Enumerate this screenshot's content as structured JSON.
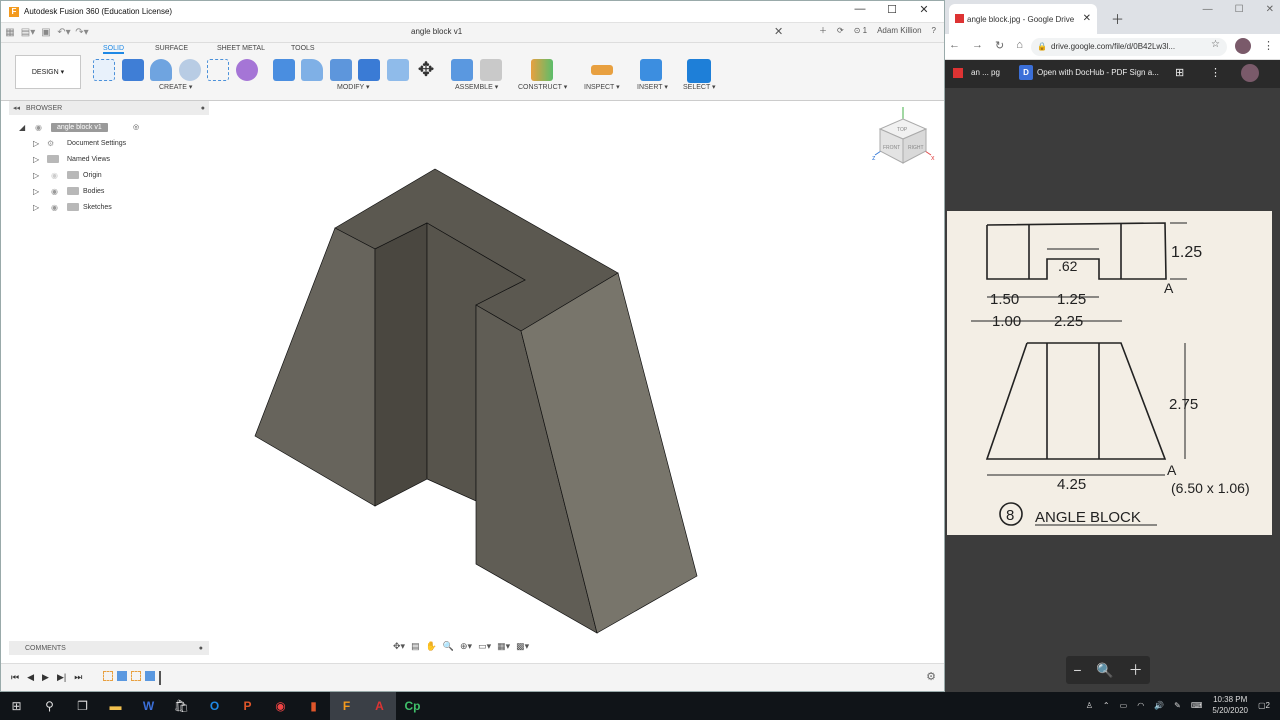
{
  "fusion": {
    "window_title": "Autodesk Fusion 360 (Education License)",
    "doc_tab": "angle block v1",
    "user": "Adam Killion",
    "notif_count": "1",
    "ribbon_tabs": [
      "SOLID",
      "SURFACE",
      "SHEET METAL",
      "TOOLS"
    ],
    "workspace": "DESIGN",
    "groups": [
      "CREATE",
      "MODIFY",
      "ASSEMBLE",
      "CONSTRUCT",
      "INSPECT",
      "INSERT",
      "SELECT"
    ],
    "browser": {
      "title": "BROWSER",
      "root": "angle block v1",
      "items": [
        "Document Settings",
        "Named Views",
        "Origin",
        "Bodies",
        "Sketches"
      ]
    },
    "comments": "COMMENTS",
    "viewcube": {
      "top": "TOP",
      "front": "FRONT",
      "right": "RIGHT"
    },
    "colors": {
      "accent": "#1e88e5",
      "body": "#6f6b60"
    }
  },
  "chrome": {
    "tab_title": "angle block.jpg - Google Drive",
    "url": "drive.google.com/file/d/0B42Lw3l...",
    "toolbar_file": "an ... pg",
    "open_with": "Open with DocHub - PDF Sign a..."
  },
  "drawing": {
    "dims": [
      "1.25",
      ".62",
      "1.50",
      "1.25",
      "1.00",
      "2.25",
      "2.75",
      "4.25",
      "A",
      "A",
      "(6.50 x 1.06)"
    ],
    "number": "8",
    "title": "ANGLE BLOCK"
  },
  "taskbar": {
    "time": "10:38 PM",
    "date": "5/20/2020",
    "notifications": "2"
  }
}
